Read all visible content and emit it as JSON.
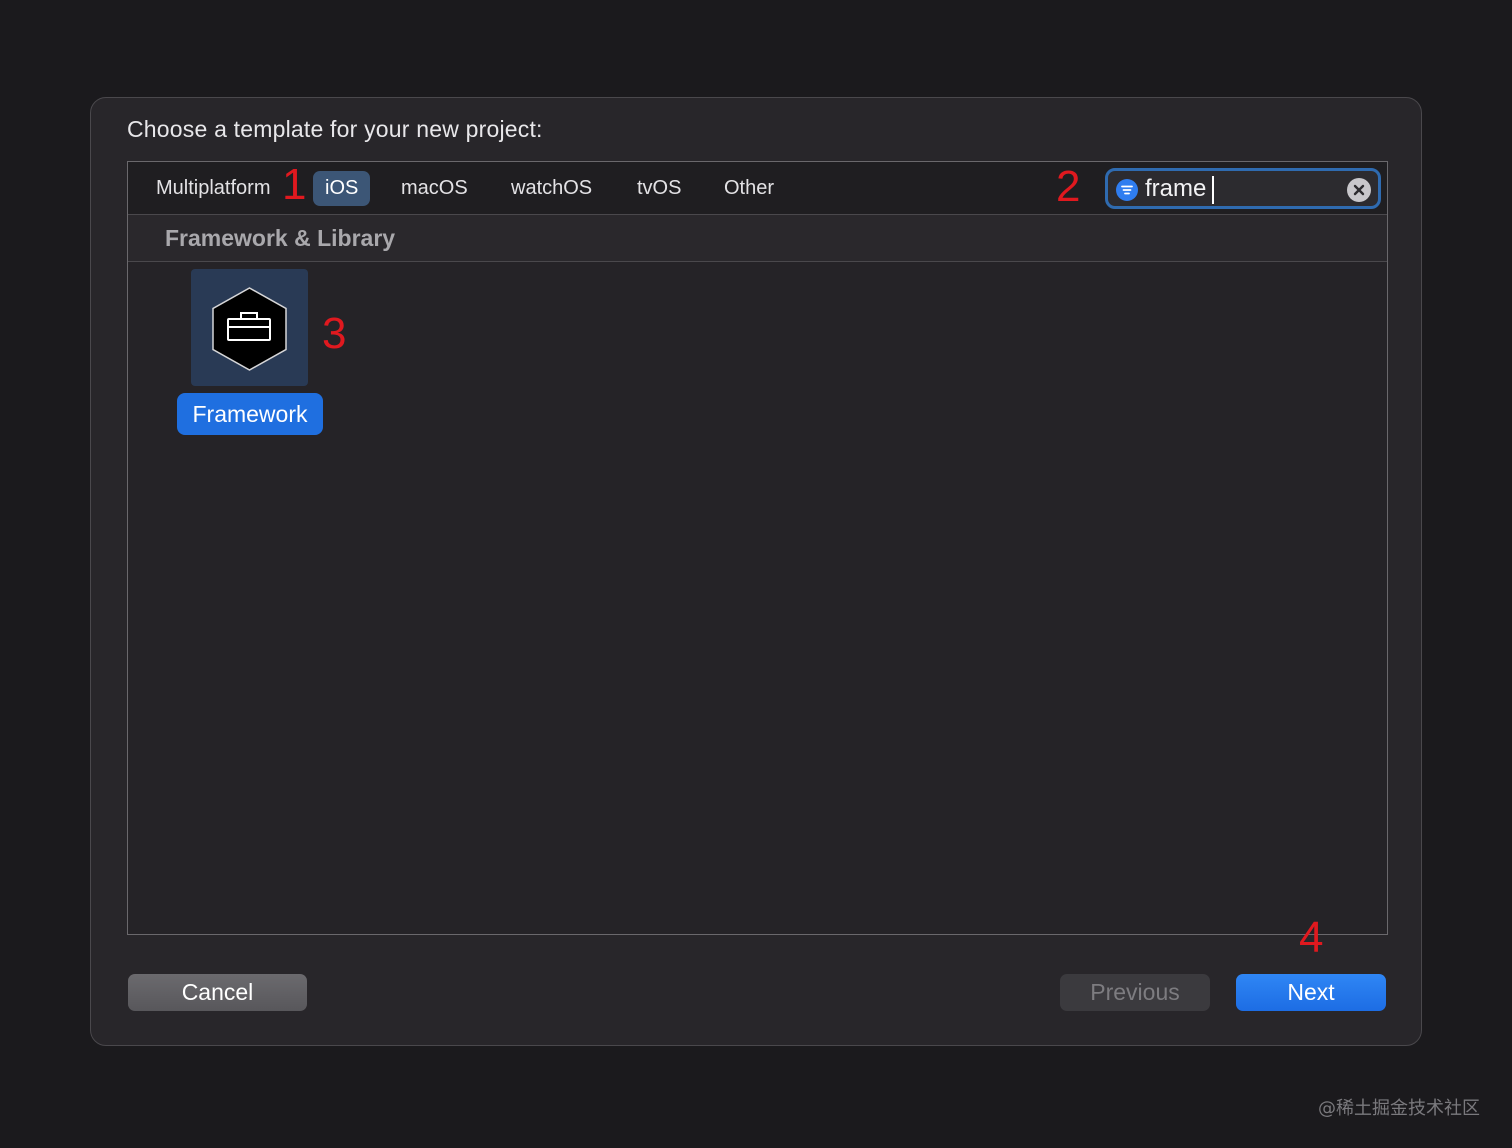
{
  "dialog": {
    "title": "Choose a template for your new project:"
  },
  "tabs": [
    {
      "label": "Multiplatform",
      "selected": false
    },
    {
      "label": "iOS",
      "selected": true
    },
    {
      "label": "macOS",
      "selected": false
    },
    {
      "label": "watchOS",
      "selected": false
    },
    {
      "label": "tvOS",
      "selected": false
    },
    {
      "label": "Other",
      "selected": false
    }
  ],
  "search": {
    "value": "frame",
    "filter_icon": "filter-icon",
    "clear_icon": "clear-icon"
  },
  "section": {
    "title": "Framework & Library"
  },
  "templates": [
    {
      "label": "Framework",
      "icon": "toolbox-hexagon-icon",
      "selected": true
    }
  ],
  "annotations": [
    "1",
    "2",
    "3",
    "4"
  ],
  "buttons": {
    "cancel": "Cancel",
    "previous": "Previous",
    "next": "Next"
  },
  "watermark": "@稀土掘金技术社区",
  "colors": {
    "accent": "#1f6fe0",
    "annotation": "#e0191f",
    "selected_tab": "#3c5676"
  }
}
